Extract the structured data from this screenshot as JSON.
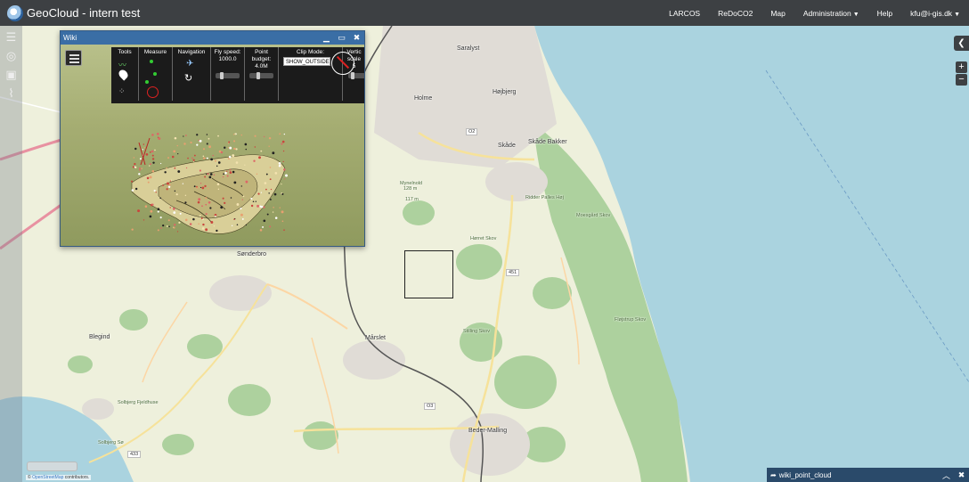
{
  "app": {
    "title": "GeoCloud - intern test"
  },
  "nav": {
    "items": [
      "LARCOS",
      "ReDoCO2",
      "Map"
    ],
    "administration": "Administration",
    "help": "Help",
    "user": "kfu@i-gis.dk"
  },
  "wiki": {
    "title": "Wiki",
    "toolbar": {
      "tools": "Tools",
      "measure": "Measure",
      "navigation": "Navigation",
      "fly_speed_label": "Fly speed:",
      "fly_speed_value": "1000.0",
      "point_budget_label": "Point budget:",
      "point_budget_value": "4.0M",
      "clip_mode_label": "Clip Mode:",
      "clip_mode_value": "SHOW_OUTSIDE",
      "vertical_label": "Vertic",
      "vertical_sub": "scale",
      "vertical_value": "5"
    }
  },
  "map": {
    "places": [
      {
        "name": "Saralyst",
        "cls": ""
      },
      {
        "name": "Højbjerg",
        "cls": ""
      },
      {
        "name": "Holme",
        "cls": ""
      },
      {
        "name": "Skåde",
        "cls": ""
      },
      {
        "name": "Skåde Bakker",
        "cls": ""
      },
      {
        "name": "Mynelnold",
        "cls": "small"
      },
      {
        "name": "128 m",
        "cls": "small"
      },
      {
        "name": "117 m",
        "cls": "small"
      },
      {
        "name": "Ridder Palles Høj",
        "cls": "small"
      },
      {
        "name": "Moesgård Skov",
        "cls": "small"
      },
      {
        "name": "Hørret Skov",
        "cls": "small"
      },
      {
        "name": "Sønderbro",
        "cls": ""
      },
      {
        "name": "Mårslet",
        "cls": ""
      },
      {
        "name": "Fløjstrup Skov",
        "cls": "small"
      },
      {
        "name": "Blegind",
        "cls": ""
      },
      {
        "name": "Solbjerg Fjeldhuse",
        "cls": "small"
      },
      {
        "name": "Solbjerg Sø",
        "cls": "small"
      },
      {
        "name": "Beder-Malling",
        "cls": ""
      },
      {
        "name": "Stilling Skov",
        "cls": "small"
      }
    ],
    "roads": [
      "O2",
      "451",
      "O3",
      "433"
    ],
    "attribution_prefix": "© ",
    "attribution_link": "OpenStreetMap",
    "attribution_suffix": " contributors."
  },
  "layer_panel": {
    "name": "wiki_point_cloud"
  },
  "colors": {
    "navbar": "#3d4043",
    "window_header": "#3a6ea5",
    "sea": "#aad3df",
    "land": "#f2efe9",
    "forest": "#add19e"
  }
}
